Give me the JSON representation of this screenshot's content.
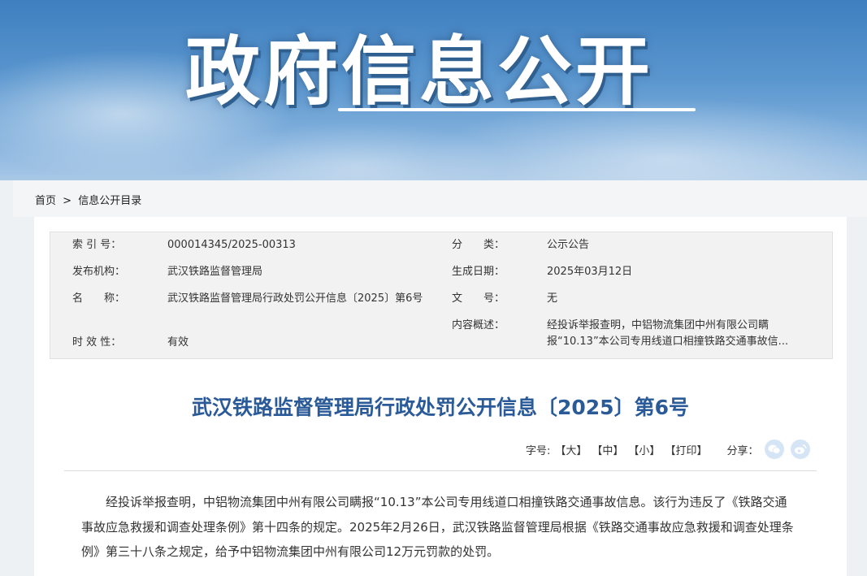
{
  "banner": {
    "title": "政府信息公开"
  },
  "breadcrumb": {
    "home": "首页",
    "sep": ">",
    "current": "信息公开目录"
  },
  "meta": {
    "index_label": "索 引 号：",
    "index_value": "000014345/2025-00313",
    "category_label": "分　　类：",
    "category_value": "公示公告",
    "publisher_label": "发布机构：",
    "publisher_value": "武汉铁路监督管理局",
    "date_label": "生成日期：",
    "date_value": "2025年03月12日",
    "name_label": "名　　称：",
    "name_value": "武汉铁路监督管理局行政处罚公开信息〔2025〕第6号",
    "docno_label": "文　　号：",
    "docno_value": "无",
    "summary_label": "内容概述：",
    "summary_value": "经投诉举报查明，中铝物流集团中州有限公司瞒报“10.13”本公司专用线道口相撞铁路交通事故信...",
    "validity_label": "时 效 性：",
    "validity_value": "有效"
  },
  "document": {
    "title": "武汉铁路监督管理局行政处罚公开信息〔2025〕第6号"
  },
  "tools": {
    "fontsize_label": "字号:",
    "large": "【大】",
    "medium": "【中】",
    "small": "【小】",
    "print": "【打印】",
    "share_label": "分享："
  },
  "icons": {
    "wechat": "wechat-icon",
    "weibo": "weibo-icon"
  },
  "content": {
    "paragraph": "经投诉举报查明，中铝物流集团中州有限公司瞒报“10.13”本公司专用线道口相撞铁路交通事故信息。该行为违反了《铁路交通事故应急救援和调查处理条例》第十四条的规定。2025年2月26日，武汉铁路监督管理局根据《铁路交通事故应急救援和调查处理条例》第三十八条之规定，给予中铝物流集团中州有限公司12万元罚款的处罚。"
  }
}
